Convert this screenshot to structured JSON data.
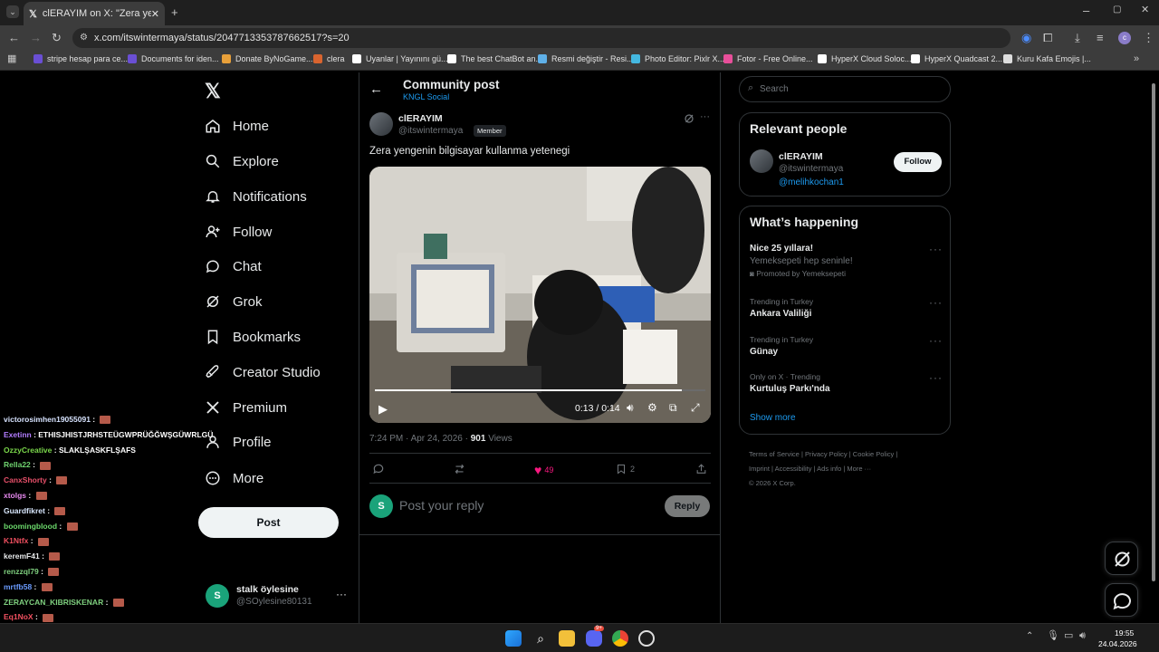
{
  "browser": {
    "tab_title": "clERAYIM on X: \"Zera yengenin",
    "url": "x.com/itswintermaya/status/2047713353787662517?s=20",
    "bookmarks": [
      {
        "label": "stripe hesap para ce...",
        "color": "#6a4fd4"
      },
      {
        "label": "Documents for iden...",
        "color": "#6a4fd4"
      },
      {
        "label": "Donate ByNoGame...",
        "color": "#e8a03a"
      },
      {
        "label": "clera",
        "color": "#d9642f"
      },
      {
        "label": "Uyanlar | Yayınını gü...",
        "color": "#ffffff"
      },
      {
        "label": "The best ChatBot an...",
        "color": "#ffffff"
      },
      {
        "label": "Resmi değiştir - Resi...",
        "color": "#5fb0e8"
      },
      {
        "label": "Photo Editor: Pixlr X...",
        "color": "#44b8e0"
      },
      {
        "label": "Fotor - Free Online...",
        "color": "#e84f9a"
      },
      {
        "label": "HyperX Cloud Soloc...",
        "color": "#ffffff"
      },
      {
        "label": "HyperX Quadcast 2...",
        "color": "#ffffff"
      },
      {
        "label": "Kuru Kafa Emojis |...",
        "color": "#dddddd"
      }
    ]
  },
  "nav": {
    "items": [
      {
        "label": "Home",
        "icon": "home-icon"
      },
      {
        "label": "Explore",
        "icon": "search-icon"
      },
      {
        "label": "Notifications",
        "icon": "bell-icon"
      },
      {
        "label": "Follow",
        "icon": "person-add-icon"
      },
      {
        "label": "Chat",
        "icon": "chat-icon"
      },
      {
        "label": "Grok",
        "icon": "grok-icon"
      },
      {
        "label": "Bookmarks",
        "icon": "bookmark-icon"
      },
      {
        "label": "Creator Studio",
        "icon": "rocket-icon"
      },
      {
        "label": "Premium",
        "icon": "x-logo-icon"
      },
      {
        "label": "Profile",
        "icon": "person-icon"
      },
      {
        "label": "More",
        "icon": "more-circle-icon"
      }
    ],
    "post_button": "Post",
    "account": {
      "name": "stalk öylesine",
      "handle": "@SOylesine80131",
      "avatar_letter": "S"
    }
  },
  "chat": [
    {
      "user": "victorosimhen19055091",
      "msg": "",
      "color": "#d7e3ff",
      "emote": true
    },
    {
      "user": "Exetinn",
      "msg": "ETHISJHISTJRHSTEÜGWPRÜĞĞWŞGÜWRLGÜ",
      "color": "#b27cff",
      "emote": false
    },
    {
      "user": "OzzyCreative",
      "msg": "SLAKLŞASKFLŞAFS",
      "color": "#7bd84b",
      "emote": false
    },
    {
      "user": "Rella22",
      "msg": "",
      "color": "#6fd36f",
      "emote": true
    },
    {
      "user": "CanxShorty",
      "msg": "",
      "color": "#e8506a",
      "emote": true
    },
    {
      "user": "xtolgs",
      "msg": "",
      "color": "#e88af0",
      "emote": true
    },
    {
      "user": "Guardfikret",
      "msg": "",
      "color": "#d9e8ff",
      "emote": true
    },
    {
      "user": "boomingblood",
      "msg": "",
      "color": "#6bd86b",
      "emote": true
    },
    {
      "user": "K1Ntfx",
      "msg": "",
      "color": "#f05060",
      "emote": true
    },
    {
      "user": "keremF41",
      "msg": "",
      "color": "#e7e9ea",
      "emote": true
    },
    {
      "user": "renzzql79",
      "msg": "",
      "color": "#7fd07f",
      "emote": true
    },
    {
      "user": "mrtfb58",
      "msg": "",
      "color": "#6a9bff",
      "emote": true
    },
    {
      "user": "ZERAYCAN_KIBRISKENAR",
      "msg": "",
      "color": "#7fd07f",
      "emote": true
    },
    {
      "user": "Eq1NoX",
      "msg": "",
      "color": "#f05060",
      "emote": true
    }
  ],
  "post": {
    "header_title": "Community post",
    "community": "KNGL Social",
    "author_name": "clERAYIM",
    "author_handle": "@itswintermaya",
    "badge": "Member",
    "text": "Zera yengenin bilgisayar kullanma yetenegi",
    "video_time": "0:13 / 0:14",
    "video_progress": 0.93,
    "time_meta": "7:24 PM · Apr 24, 2026 · ",
    "views_count": "901",
    "views_label": " Views",
    "likes": "49",
    "bookmarks": "2",
    "reply_placeholder": "Post your reply",
    "reply_button": "Reply",
    "reply_avatar_letter": "S"
  },
  "sidebar": {
    "search_placeholder": "Search",
    "relevant_title": "Relevant people",
    "person": {
      "name": "clERAYIM",
      "handle": "@itswintermaya",
      "mention": "@melihkochan1",
      "follow_label": "Follow"
    },
    "happening_title": "What’s happening",
    "promo": {
      "title": "Nice 25 yıllara!",
      "text": "Yemeksepeti hep seninle!",
      "promoted": "Promoted by Yemeksepeti"
    },
    "trends": [
      {
        "context": "Trending in Turkey",
        "topic": "Ankara Valiliği"
      },
      {
        "context": "Trending in Turkey",
        "topic": "Günay"
      },
      {
        "context": "Only on X · Trending",
        "topic": "Kurtuluş Parkı'nda"
      }
    ],
    "show_more": "Show more",
    "footer": {
      "row1": [
        "Terms of Service",
        "Privacy Policy",
        "Cookie Policy"
      ],
      "row2": [
        "Imprint",
        "Accessibility",
        "Ads info",
        "More ···"
      ],
      "copyright": "© 2026 X Corp."
    }
  },
  "taskbar": {
    "time": "19:55",
    "date": "24.04.2026",
    "discord_badge": "9+"
  },
  "colors": {
    "accent": "#1d9bf0",
    "like": "#f91880",
    "bg": "#000000",
    "border": "#2f3336"
  }
}
